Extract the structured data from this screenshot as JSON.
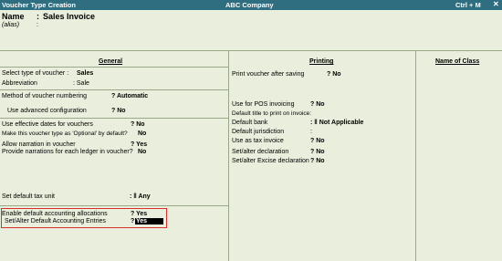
{
  "titlebar": {
    "title": "Voucher Type Creation",
    "company": "ABC Company",
    "shortcut": "Ctrl + M",
    "close": "✕"
  },
  "header": {
    "name_label": "Name",
    "name_value": "Sales Invoice",
    "alias_label": "(alias)",
    "name_colon": ":",
    "alias_colon": ":"
  },
  "general": {
    "heading": "General",
    "select_type_label": "Select type of voucher :",
    "select_type_value": "Sales",
    "abbreviation_label": "Abbreviation",
    "abbreviation_value": ": Sale",
    "numbering_label": "Method of voucher numbering",
    "numbering_value": "? Automatic",
    "adv_config_label": "Use advanced configuration",
    "adv_config_value": "? No",
    "eff_dates_label": "Use effective dates for vouchers",
    "eff_dates_value": "? No",
    "optional_label": "Make this voucher type as 'Optional' by default?",
    "optional_value": "No",
    "narration_label": "Allow narration in voucher",
    "narration_value": "? Yes",
    "ledger_narr_label": "Provide narrations for each ledger in voucher?",
    "ledger_narr_value": "No",
    "tax_unit_label": "Set default tax unit",
    "tax_unit_value": ": ‖ Any",
    "def_alloc_label": "Enable default accounting allocations",
    "def_alloc_value": "? Yes",
    "set_alter_label": "Set/Alter Default Accounting Entries",
    "set_alter_q": "?",
    "set_alter_value": "Yes"
  },
  "printing": {
    "heading": "Printing",
    "print_after_label": "Print voucher after saving",
    "print_after_value": "? No",
    "pos_label": "Use for POS invoicing",
    "pos_value": "? No",
    "default_title_label": "Default title to print on invoice:",
    "default_bank_label": "Default bank",
    "default_bank_value": ": ‖ Not Applicable",
    "default_juris_label": "Default jurisdiction",
    "default_juris_value": ":",
    "tax_invoice_label": "Use as tax invoice",
    "tax_invoice_value": "? No",
    "set_alter_decl_label": "Set/alter declaration",
    "set_alter_decl_value": "? No",
    "excise_label": "Set/alter Excise declaration",
    "excise_value": "? No"
  },
  "class": {
    "heading": "Name of Class"
  }
}
